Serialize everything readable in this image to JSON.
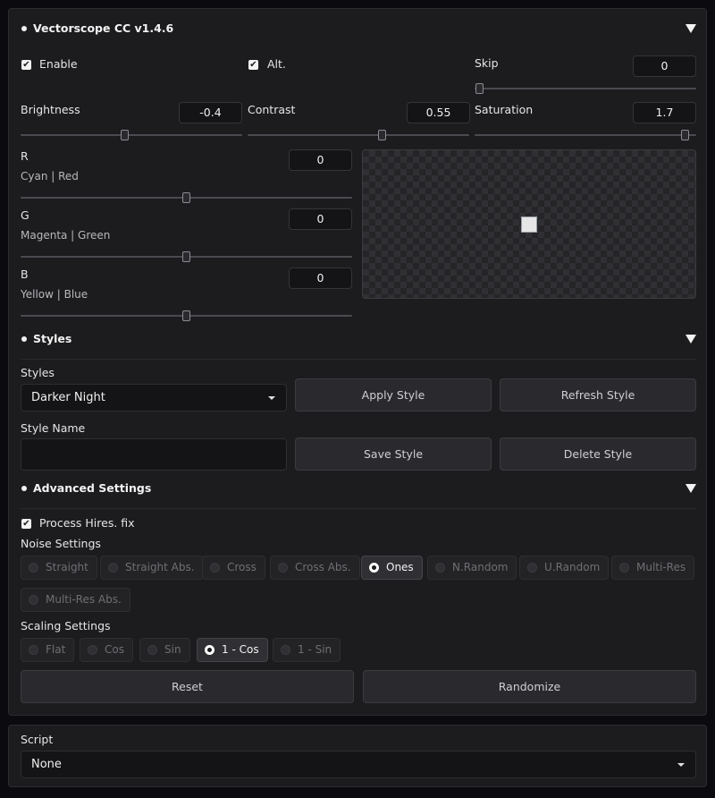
{
  "vectorscope": {
    "title": "Vectorscope CC v1.4.6",
    "enable": {
      "label": "Enable",
      "checked": true
    },
    "alt": {
      "label": "Alt.",
      "checked": true
    },
    "skip": {
      "label": "Skip",
      "value": "0",
      "slider_fraction": 0.0
    },
    "brightness": {
      "label": "Brightness",
      "value": "-0.4",
      "slider_fraction": 0.47
    },
    "contrast": {
      "label": "Contrast",
      "value": "0.55",
      "slider_fraction": 0.6
    },
    "saturation": {
      "label": "Saturation",
      "value": "1.7",
      "slider_fraction": 0.95
    },
    "r": {
      "label": "R",
      "sublabel": "Cyan | Red",
      "value": "0",
      "slider_fraction": 0.5
    },
    "g": {
      "label": "G",
      "sublabel": "Magenta | Green",
      "value": "0",
      "slider_fraction": 0.5
    },
    "b": {
      "label": "B",
      "sublabel": "Yellow | Blue",
      "value": "0",
      "slider_fraction": 0.5
    },
    "preview_icon": "broken-image-icon"
  },
  "styles": {
    "title": "Styles",
    "styles_label": "Styles",
    "selected_style": "Darker Night",
    "apply_button": "Apply Style",
    "refresh_button": "Refresh Style",
    "style_name_label": "Style Name",
    "style_name_value": "",
    "save_button": "Save Style",
    "delete_button": "Delete Style"
  },
  "advanced": {
    "title": "Advanced Settings",
    "process_hires": {
      "label": "Process Hires. fix",
      "checked": true
    },
    "noise_label": "Noise Settings",
    "noise_options": [
      "Straight",
      "Straight Abs.",
      "Cross",
      "Cross Abs.",
      "Ones",
      "N.Random",
      "U.Random",
      "Multi-Res",
      "Multi-Res Abs."
    ],
    "noise_selected": "Ones",
    "scaling_label": "Scaling Settings",
    "scaling_options": [
      "Flat",
      "Cos",
      "Sin",
      "1 - Cos",
      "1 - Sin"
    ],
    "scaling_selected": "1 - Cos",
    "reset_button": "Reset",
    "randomize_button": "Randomize"
  },
  "script": {
    "label": "Script",
    "selected": "None"
  },
  "colors": {
    "background": "#0b0b0f",
    "panel": "#1c1c1f",
    "text": "#e8e8ea"
  }
}
